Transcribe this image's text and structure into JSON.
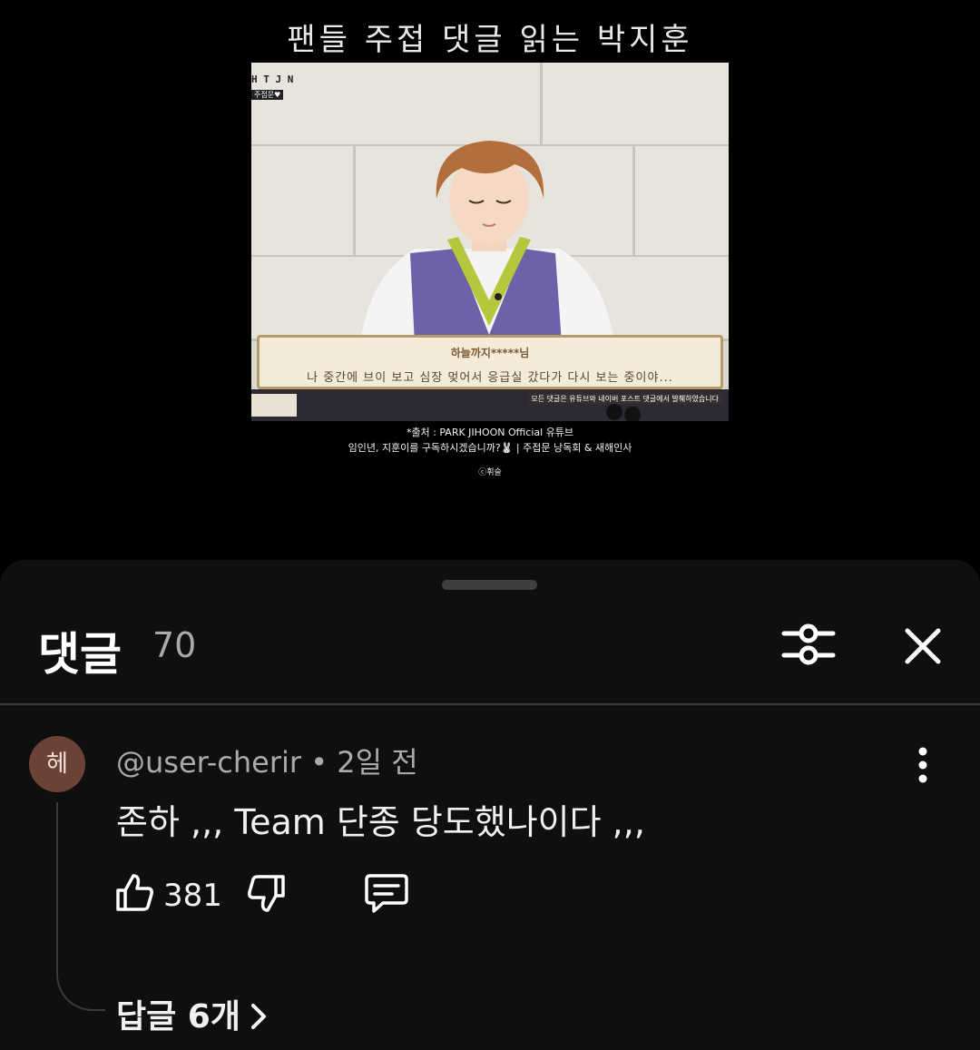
{
  "video": {
    "title": "팬들 주접 댓글 읽는 박지훈",
    "channel_logo": "H T J N",
    "channel_sub": "주접문♥",
    "banner_name": "하늘까지*****님",
    "banner_text": "나 중간에 브이 보고 심장 멎어서 응급실 갔다가 다시 보는 중이야...",
    "banner_credit": "모든 댓글은 유튜브와 네이버 포스트 댓글에서 발췌하였습니다",
    "caption_source": "*출처 : PARK JIHOON Official 유튜브",
    "caption_line2": "임인년, 지훈이를 구독하시겠습니까?🐰  |  주접문 낭독회 & 새해인사",
    "caption_credit": "ⓒ휘슬"
  },
  "comments_sheet": {
    "title": "댓글",
    "count": "70",
    "icons": {
      "filter": "sliders-icon",
      "close": "close-icon",
      "more": "more-vert-icon",
      "like": "thumbs-up-icon",
      "dislike": "thumbs-down-icon",
      "reply": "reply-bubble-icon",
      "chevron": "chevron-right-icon"
    }
  },
  "comment": {
    "avatar_initial": "헤",
    "avatar_color": "#6b4236",
    "author": "@user-cherir",
    "separator": "•",
    "time": "2일 전",
    "text": "존하 ,,, Team 단종 당도했나이다 ,,,",
    "like_count": "381",
    "replies_label": "답글 6개"
  }
}
